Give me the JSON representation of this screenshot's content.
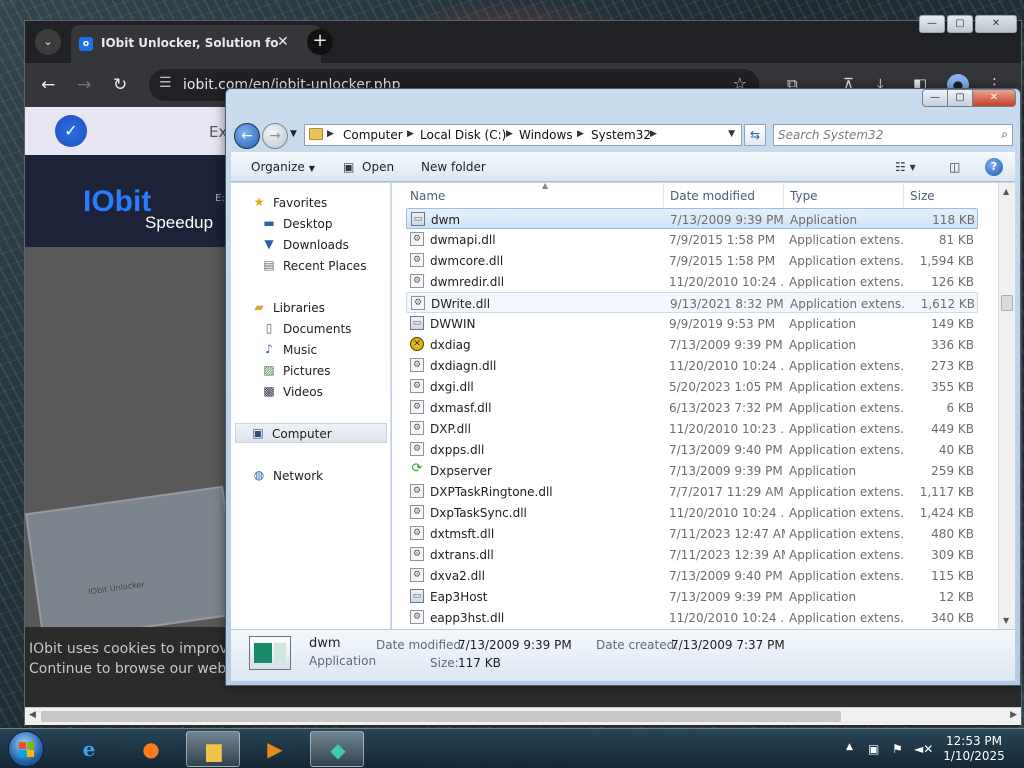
{
  "browser": {
    "tab_title": "IObit Unlocker, Solution for \"u",
    "tab_favicon": "o",
    "url": "iobit.com/en/iobit-unlocker.php",
    "promo_text": "Ex",
    "logo_text": "IObit",
    "logo_sub": "Speedup",
    "logo_side": "E:",
    "cookie_line1": "IObit uses cookies to improve c",
    "cookie_line2": "Continue to browse our website",
    "mini_window_title": "IObit Unlocker"
  },
  "explorer": {
    "breadcrumbs": [
      "Computer",
      "Local Disk (C:)",
      "Windows",
      "System32"
    ],
    "search_placeholder": "Search System32",
    "toolbar": {
      "organize": "Organize",
      "open": "Open",
      "new_folder": "New folder"
    },
    "nav": {
      "favorites": "Favorites",
      "desktop": "Desktop",
      "downloads": "Downloads",
      "recent": "Recent Places",
      "libraries": "Libraries",
      "documents": "Documents",
      "music": "Music",
      "pictures": "Pictures",
      "videos": "Videos",
      "computer": "Computer",
      "network": "Network"
    },
    "columns": {
      "name": "Name",
      "date": "Date modified",
      "type": "Type",
      "size": "Size"
    },
    "files": [
      {
        "name": "dwm",
        "date": "7/13/2009 9:39 PM",
        "type": "Application",
        "size": "118 KB",
        "icon": "app"
      },
      {
        "name": "dwmapi.dll",
        "date": "7/9/2015 1:58 PM",
        "type": "Application extens...",
        "size": "81 KB",
        "icon": "dll"
      },
      {
        "name": "dwmcore.dll",
        "date": "7/9/2015 1:58 PM",
        "type": "Application extens...",
        "size": "1,594 KB",
        "icon": "dll"
      },
      {
        "name": "dwmredir.dll",
        "date": "11/20/2010 10:24 ...",
        "type": "Application extens...",
        "size": "126 KB",
        "icon": "dll"
      },
      {
        "name": "DWrite.dll",
        "date": "9/13/2021 8:32 PM",
        "type": "Application extens...",
        "size": "1,612 KB",
        "icon": "dll"
      },
      {
        "name": "DWWIN",
        "date": "9/9/2019 9:53 PM",
        "type": "Application",
        "size": "149 KB",
        "icon": "app"
      },
      {
        "name": "dxdiag",
        "date": "7/13/2009 9:39 PM",
        "type": "Application",
        "size": "336 KB",
        "icon": "x"
      },
      {
        "name": "dxdiagn.dll",
        "date": "11/20/2010 10:24 ...",
        "type": "Application extens...",
        "size": "273 KB",
        "icon": "dll"
      },
      {
        "name": "dxgi.dll",
        "date": "5/20/2023 1:05 PM",
        "type": "Application extens...",
        "size": "355 KB",
        "icon": "dll"
      },
      {
        "name": "dxmasf.dll",
        "date": "6/13/2023 7:32 PM",
        "type": "Application extens...",
        "size": "6 KB",
        "icon": "dll"
      },
      {
        "name": "DXP.dll",
        "date": "11/20/2010 10:23 ...",
        "type": "Application extens...",
        "size": "449 KB",
        "icon": "dll"
      },
      {
        "name": "dxpps.dll",
        "date": "7/13/2009 9:40 PM",
        "type": "Application extens...",
        "size": "40 KB",
        "icon": "dll"
      },
      {
        "name": "Dxpserver",
        "date": "7/13/2009 9:39 PM",
        "type": "Application",
        "size": "259 KB",
        "icon": "g"
      },
      {
        "name": "DXPTaskRingtone.dll",
        "date": "7/7/2017 11:29 AM",
        "type": "Application extens...",
        "size": "1,117 KB",
        "icon": "dll"
      },
      {
        "name": "DxpTaskSync.dll",
        "date": "11/20/2010 10:24 ...",
        "type": "Application extens...",
        "size": "1,424 KB",
        "icon": "dll"
      },
      {
        "name": "dxtmsft.dll",
        "date": "7/11/2023 12:47 AM",
        "type": "Application extens...",
        "size": "480 KB",
        "icon": "dll"
      },
      {
        "name": "dxtrans.dll",
        "date": "7/11/2023 12:39 AM",
        "type": "Application extens...",
        "size": "309 KB",
        "icon": "dll"
      },
      {
        "name": "dxva2.dll",
        "date": "7/13/2009 9:40 PM",
        "type": "Application extens...",
        "size": "115 KB",
        "icon": "dll"
      },
      {
        "name": "Eap3Host",
        "date": "7/13/2009 9:39 PM",
        "type": "Application",
        "size": "12 KB",
        "icon": "app"
      },
      {
        "name": "eapp3hst.dll",
        "date": "11/20/2010 10:24 ...",
        "type": "Application extens...",
        "size": "340 KB",
        "icon": "dll"
      }
    ],
    "details": {
      "name": "dwm",
      "kind": "Application",
      "modified_label": "Date modified:",
      "modified_value": "7/13/2009 9:39 PM",
      "created_label": "Date created:",
      "created_value": "7/13/2009 7:37 PM",
      "size_label": "Size:",
      "size_value": "117 KB"
    }
  },
  "taskbar": {
    "time": "12:53 PM",
    "date": "1/10/2025"
  },
  "colors": {
    "selection": "#cfe2f8",
    "iobit_blue": "#2b7bff",
    "chrome_dark": "#202124"
  }
}
